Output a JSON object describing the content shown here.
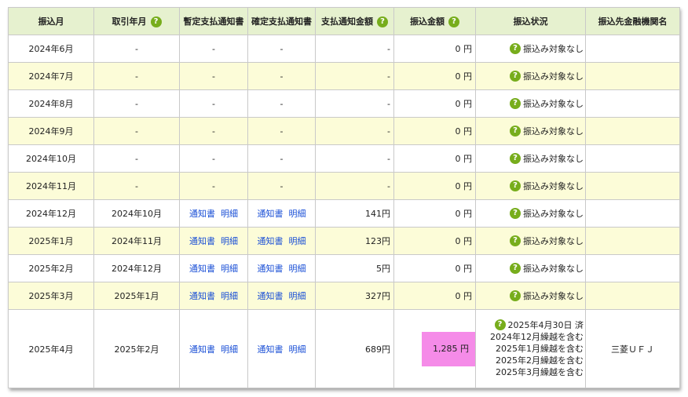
{
  "headers": {
    "transfer_month": "振込月",
    "transaction_month": "取引年月",
    "provisional_notice": "暫定支払通知書",
    "final_notice": "確定支払通知書",
    "notice_amount": "支払通知金額",
    "transfer_amount": "振込金額",
    "transfer_status": "振込状況",
    "bank_name": "振込先金融機関名"
  },
  "help_icon_glyph": "?",
  "link_labels": {
    "notice": "通知書",
    "detail": "明細"
  },
  "rows": [
    {
      "month": "2024年6月",
      "trade": "-",
      "prov": "-",
      "final": "-",
      "notice_amount": "-",
      "amount": "0 円",
      "status": "振込み対象なし",
      "bank": ""
    },
    {
      "month": "2024年7月",
      "trade": "-",
      "prov": "-",
      "final": "-",
      "notice_amount": "-",
      "amount": "0 円",
      "status": "振込み対象なし",
      "bank": ""
    },
    {
      "month": "2024年8月",
      "trade": "-",
      "prov": "-",
      "final": "-",
      "notice_amount": "-",
      "amount": "0 円",
      "status": "振込み対象なし",
      "bank": ""
    },
    {
      "month": "2024年9月",
      "trade": "-",
      "prov": "-",
      "final": "-",
      "notice_amount": "-",
      "amount": "0 円",
      "status": "振込み対象なし",
      "bank": ""
    },
    {
      "month": "2024年10月",
      "trade": "-",
      "prov": "-",
      "final": "-",
      "notice_amount": "-",
      "amount": "0 円",
      "status": "振込み対象なし",
      "bank": ""
    },
    {
      "month": "2024年11月",
      "trade": "-",
      "prov": "-",
      "final": "-",
      "notice_amount": "-",
      "amount": "0 円",
      "status": "振込み対象なし",
      "bank": ""
    },
    {
      "month": "2024年12月",
      "trade": "2024年10月",
      "notice_amount": "141円",
      "amount": "0 円",
      "status": "振込み対象なし",
      "bank": ""
    },
    {
      "month": "2025年1月",
      "trade": "2024年11月",
      "notice_amount": "123円",
      "amount": "0 円",
      "status": "振込み対象なし",
      "bank": ""
    },
    {
      "month": "2025年2月",
      "trade": "2024年12月",
      "notice_amount": "5円",
      "amount": "0 円",
      "status": "振込み対象なし",
      "bank": ""
    },
    {
      "month": "2025年3月",
      "trade": "2025年1月",
      "notice_amount": "327円",
      "amount": "0 円",
      "status": "振込み対象なし",
      "bank": ""
    },
    {
      "month": "2025年4月",
      "trade": "2025年2月",
      "notice_amount": "689円",
      "amount": "1,285 円",
      "status_lines": [
        "2025年4月30日 済",
        "2024年12月繰越を含む",
        "2025年1月繰越を含む",
        "2025年2月繰越を含む",
        "2025年3月繰越を含む"
      ],
      "bank": "三菱ＵＦＪ"
    }
  ],
  "colors": {
    "header_bg": "#e6f1cf",
    "alt_row_bg": "#fcfcd8",
    "help_icon": "#77ad1c",
    "link": "#1a4fd6",
    "highlight": "#f58be8"
  }
}
